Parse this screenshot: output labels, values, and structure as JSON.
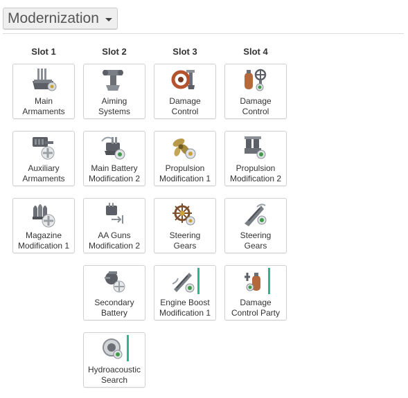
{
  "header": {
    "dropdown_label": "Modernization"
  },
  "slots": [
    {
      "title": "Slot 1",
      "items": [
        {
          "line1": "Main",
          "line2": "Armaments",
          "icon": "main-armaments-icon"
        },
        {
          "line1": "Auxiliary",
          "line2": "Armaments",
          "icon": "auxiliary-armaments-icon"
        },
        {
          "line1": "Magazine",
          "line2": "Modification 1",
          "icon": "magazine-icon"
        }
      ]
    },
    {
      "title": "Slot 2",
      "items": [
        {
          "line1": "Aiming",
          "line2": "Systems",
          "icon": "aiming-systems-icon"
        },
        {
          "line1": "Main Battery",
          "line2": "Modification 2",
          "icon": "main-battery-icon"
        },
        {
          "line1": "AA Guns",
          "line2": "Modification 2",
          "icon": "aa-guns-icon"
        },
        {
          "line1": "Secondary",
          "line2": "Battery",
          "icon": "secondary-battery-icon"
        },
        {
          "line1": "Hydroacoustic",
          "line2": "Search",
          "icon": "hydroacoustic-icon"
        }
      ]
    },
    {
      "title": "Slot 3",
      "items": [
        {
          "line1": "Damage",
          "line2": "Control",
          "icon": "damage-control-hose-icon"
        },
        {
          "line1": "Propulsion",
          "line2": "Modification 1",
          "icon": "propeller-icon"
        },
        {
          "line1": "Steering",
          "line2": "Gears",
          "icon": "ship-wheel-icon"
        },
        {
          "line1": "Engine Boost",
          "line2": "Modification 1",
          "icon": "engine-boost-icon"
        }
      ]
    },
    {
      "title": "Slot 4",
      "items": [
        {
          "line1": "Damage",
          "line2": "Control",
          "icon": "damage-control-tank-icon"
        },
        {
          "line1": "Propulsion",
          "line2": "Modification 2",
          "icon": "engine-icon"
        },
        {
          "line1": "Steering",
          "line2": "Gears",
          "icon": "rudder-icon"
        },
        {
          "line1": "Damage",
          "line2": "Control Party",
          "icon": "damage-control-party-icon"
        }
      ]
    }
  ],
  "colors": {
    "consumable_bar": "#2fb58e",
    "card_border": "#cfcfcf",
    "text": "#333333"
  }
}
